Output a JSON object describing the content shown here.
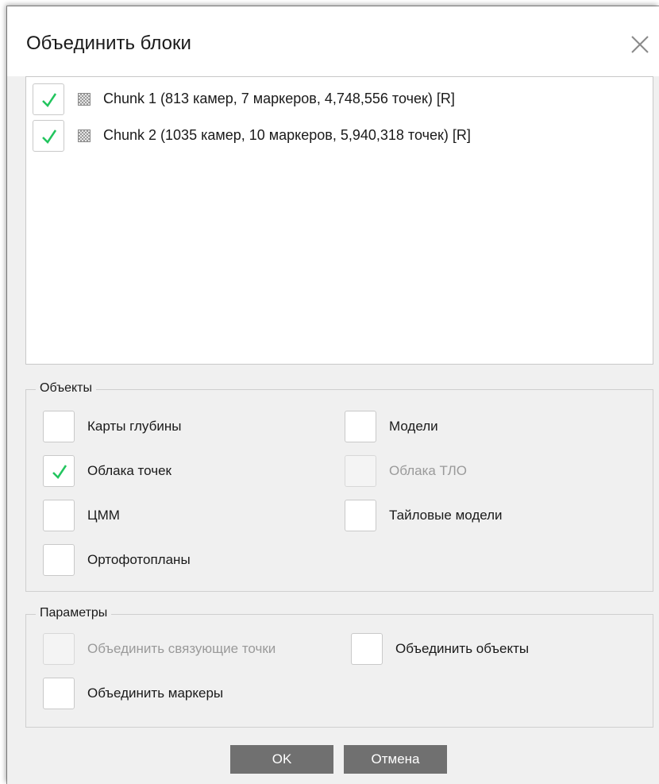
{
  "dialog": {
    "title": "Объединить блоки"
  },
  "chunks": [
    {
      "label": "Chunk 1 (813 камер, 7 маркеров, 4,748,556 точек) [R]",
      "checked": true
    },
    {
      "label": "Chunk 2 (1035 камер, 10 маркеров, 5,940,318 точек) [R]",
      "checked": true
    }
  ],
  "objects": {
    "title": "Объекты",
    "depth_maps": {
      "label": "Карты глубины",
      "checked": false
    },
    "point_clouds": {
      "label": "Облака точек",
      "checked": true
    },
    "dem": {
      "label": "ЦММ",
      "checked": false
    },
    "orthomosaics": {
      "label": "Ортофотопланы",
      "checked": false
    },
    "models": {
      "label": "Модели",
      "checked": false
    },
    "tlo_clouds": {
      "label": "Облака ТЛО",
      "checked": false,
      "disabled": true
    },
    "tiled_models": {
      "label": "Тайловые модели",
      "checked": false
    }
  },
  "params": {
    "title": "Параметры",
    "merge_tie_points": {
      "label": "Объединить связующие точки",
      "checked": false,
      "disabled": true
    },
    "merge_markers": {
      "label": "Объединить маркеры",
      "checked": false
    },
    "merge_assets": {
      "label": "Объединить объекты",
      "checked": false
    }
  },
  "buttons": {
    "ok": "OK",
    "cancel": "Отмена"
  },
  "colors": {
    "check_mark": "#22c55e",
    "button_bg": "#707070",
    "dialog_bg": "#f0f0f0"
  },
  "icons": {
    "close": "close-icon",
    "check": "checkmark-icon",
    "chunk": "chunk-icon"
  }
}
